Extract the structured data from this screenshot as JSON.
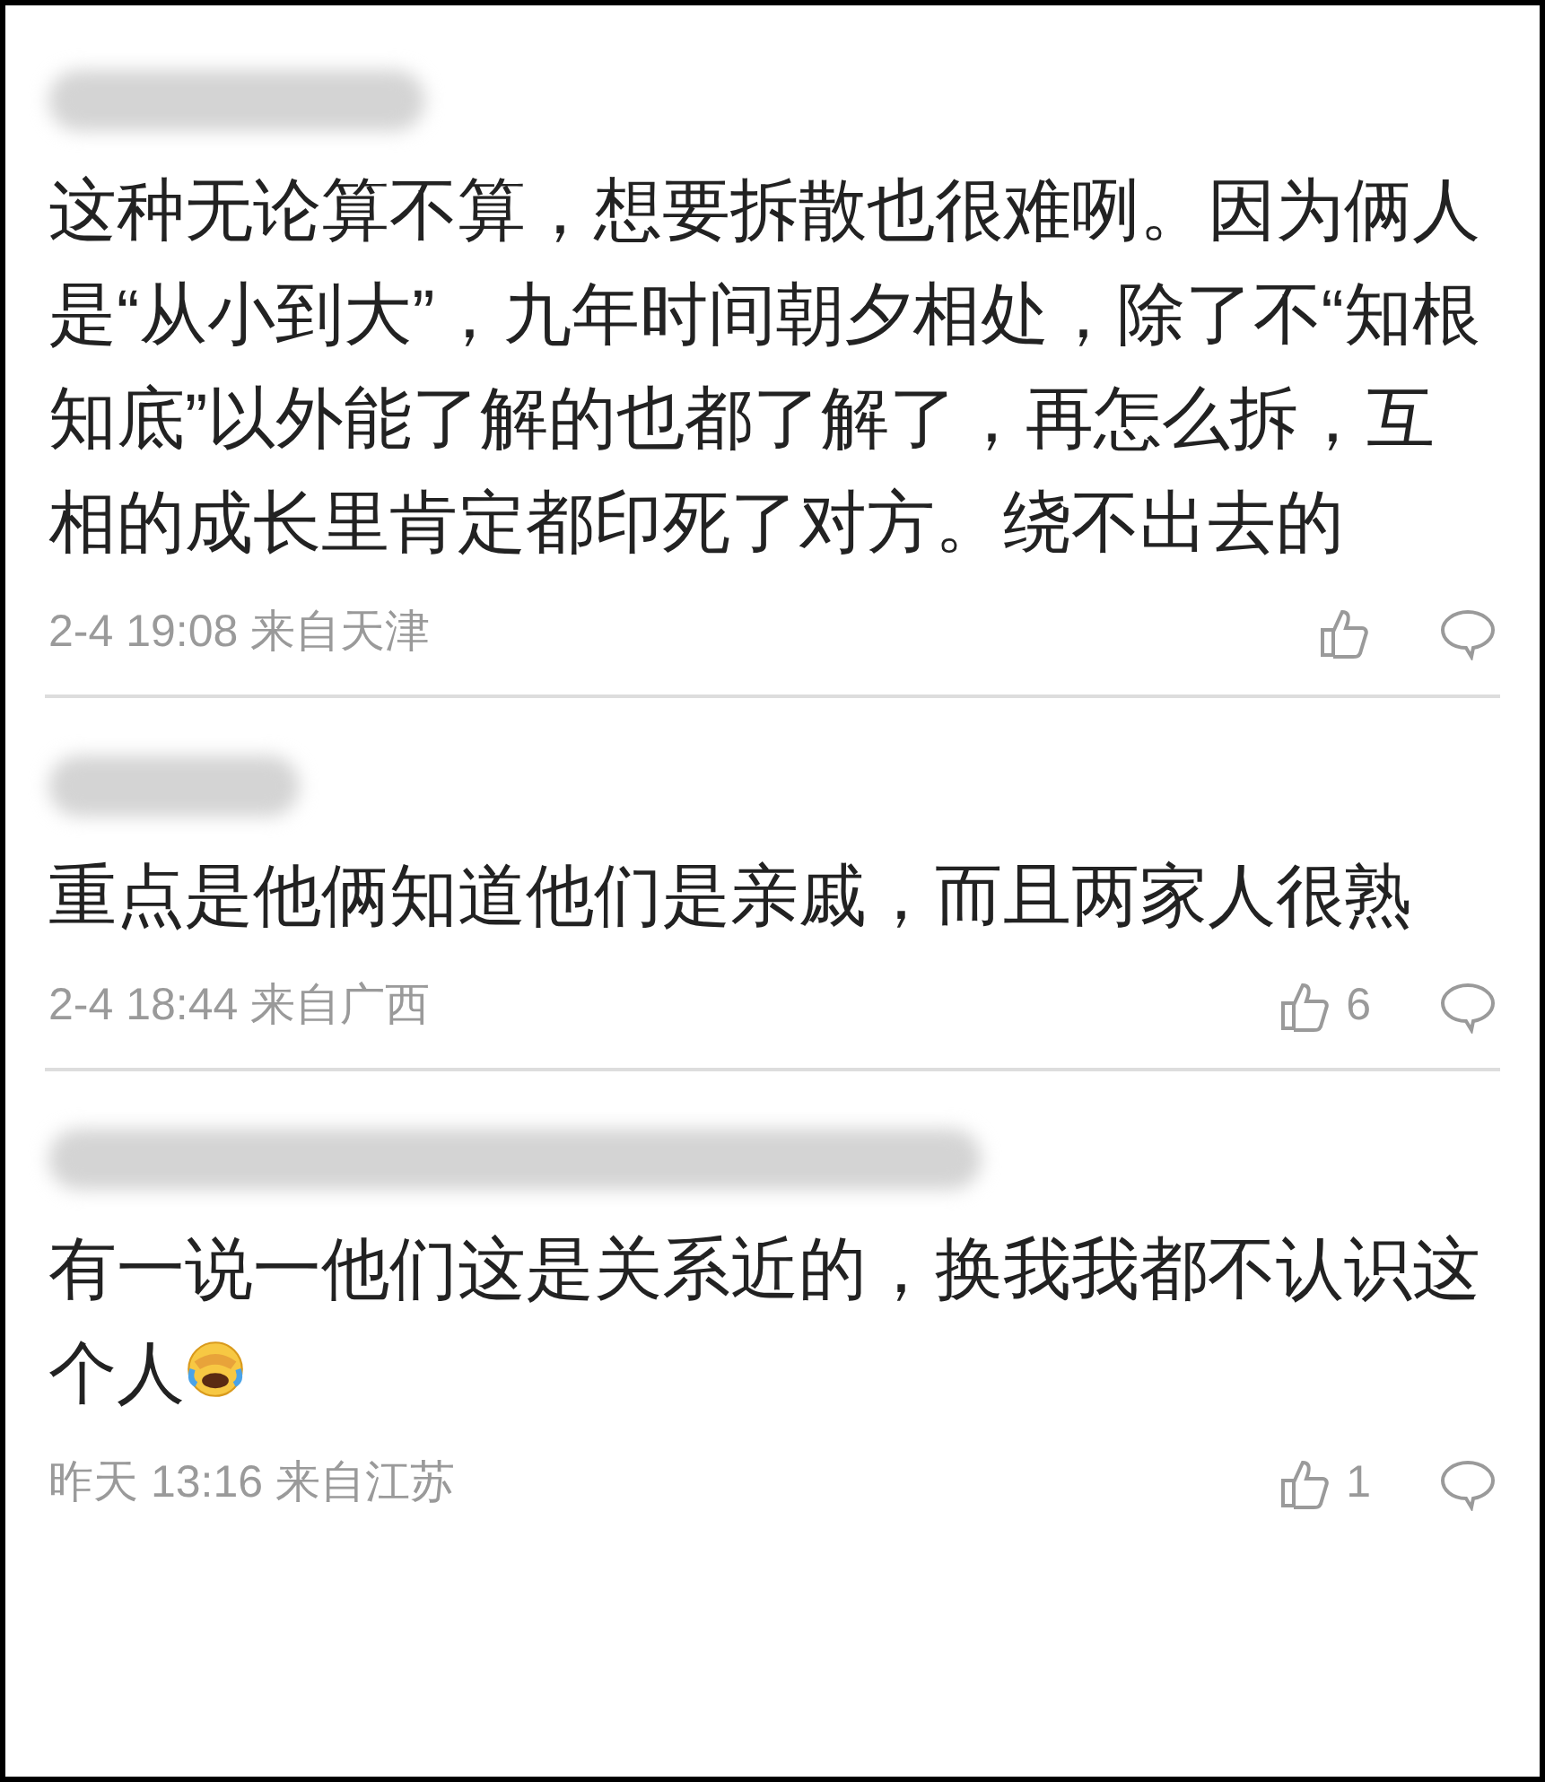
{
  "comments": [
    {
      "text": "这种无论算不算，想要拆散也很难咧。因为俩人是“从小到大”，九年时间朝夕相处，除了不“知根知底”以外能了解的也都了解了，再怎么拆，互相的成长里肯定都印死了对方。绕不出去的",
      "trailing_emoji": false,
      "time": "2-4 19:08 来自天津"
    },
    {
      "text": "重点是他俩知道他们是亲戚，而且两家人很熟",
      "trailing_emoji": false,
      "time": "2-4 18:44 来自广西",
      "likes": "6"
    },
    {
      "text": "有一说一他们这是关系近的，换我我都不认识这个人",
      "trailing_emoji": true,
      "time": "昨天 13:16 来自江苏",
      "likes": "1"
    }
  ]
}
